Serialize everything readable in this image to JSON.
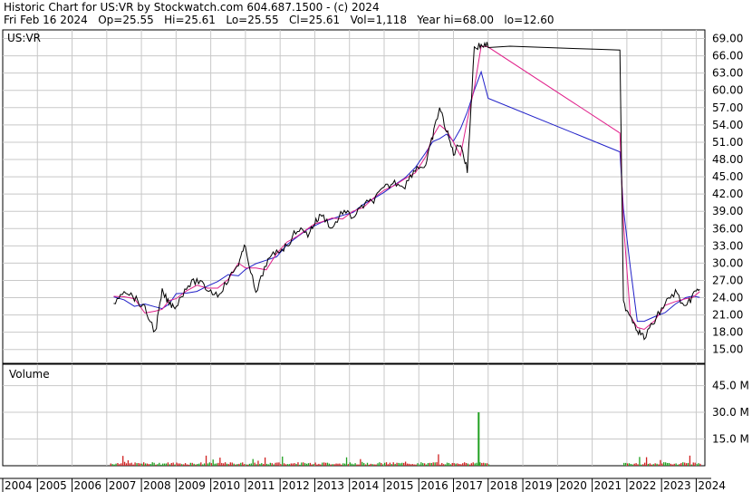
{
  "header": {
    "line1": "Historic Chart for US:VR by Stockwatch.com 604.687.1500 - (c) 2024",
    "line2": "Fri Feb 16 2024   Op=25.55   Hi=25.61   Lo=25.55   Cl=25.61   Vol=1,118   Year hi=68.00   lo=12.60"
  },
  "chart_data": [
    {
      "type": "line",
      "title": "US:VR",
      "y_ticks": [
        "69.00",
        "66.00",
        "63.00",
        "60.00",
        "57.00",
        "54.00",
        "51.00",
        "48.00",
        "45.00",
        "42.00",
        "39.00",
        "36.00",
        "33.00",
        "30.00",
        "27.00",
        "24.00",
        "21.00",
        "18.00",
        "15.00"
      ],
      "ylim": [
        12.6,
        70.5
      ],
      "x_ticks": [
        "2004",
        "2005",
        "2006",
        "2007",
        "2008",
        "2009",
        "2010",
        "2011",
        "2012",
        "2013",
        "2014",
        "2015",
        "2016",
        "2017",
        "2018",
        "2019",
        "2020",
        "2021",
        "2022",
        "2023",
        "2024"
      ],
      "grid": true,
      "colors": {
        "price": "#000000",
        "ma_short": "#e0208a",
        "ma_long": "#2020c8",
        "volume_up": "#20a020",
        "volume_down": "#d02020"
      },
      "series": [
        {
          "x": [
            2007.2,
            2007.5,
            2007.8,
            2008.1,
            2008.4,
            2008.6,
            2008.8,
            2009.0,
            2009.3,
            2009.6,
            2009.9,
            2010.2,
            2010.5,
            2010.8,
            2011.0,
            2011.3,
            2011.6,
            2011.9,
            2012.2,
            2012.5,
            2012.8,
            2013.0,
            2013.2,
            2013.5,
            2013.8,
            2014.1,
            2014.4,
            2014.7,
            2015.0,
            2015.3,
            2015.6,
            2015.9,
            2016.2,
            2016.4,
            2016.6,
            2016.8,
            2017.0,
            2017.2,
            2017.4,
            2017.6,
            2017.8,
            2018.0,
            2021.8,
            2021.9,
            2022.1,
            2022.3,
            2022.5,
            2022.8,
            2023.1,
            2023.4,
            2023.7,
            2023.9,
            2024.1
          ],
          "values": [
            23.0,
            25.5,
            24.0,
            22.0,
            18.0,
            25.0,
            23.0,
            22.5,
            26.0,
            27.0,
            25.5,
            24.5,
            27.0,
            30.0,
            33.0,
            24.5,
            30.0,
            32.0,
            33.0,
            36.0,
            35.0,
            37.0,
            38.5,
            36.0,
            39.0,
            38.0,
            40.0,
            41.0,
            43.0,
            44.0,
            43.5,
            46.5,
            47.0,
            52.0,
            57.0,
            53.0,
            49.0,
            51.0,
            46.0,
            67.5,
            67.8,
            67.8,
            67.0,
            23.0,
            21.0,
            18.5,
            17.0,
            20.0,
            23.0,
            25.0,
            22.0,
            24.5,
            25.6
          ]
        },
        {
          "name": "",
          "values": [],
          "volume_ticks": [
            "45.0 M",
            "30.0 M",
            "15.0 M"
          ],
          "label": "Volume",
          "spike": {
            "x": 2017.7,
            "value_m": 30.0
          }
        }
      ]
    }
  ]
}
